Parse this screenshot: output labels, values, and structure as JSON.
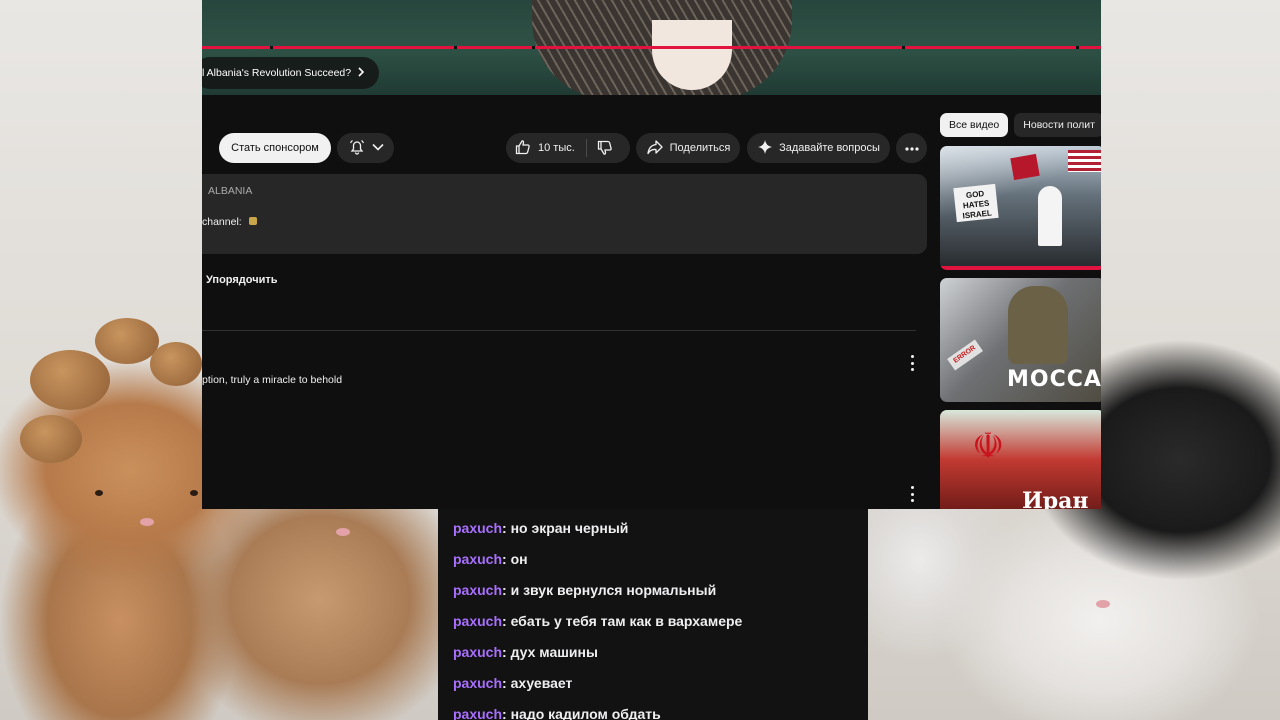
{
  "video": {
    "chapter_title": "l Albania's Revolution Succeed?"
  },
  "actions": {
    "sponsor_label": "Стать спонсором",
    "likes_count": "10 тыс.",
    "share_label": "Поделиться",
    "ask_label": "Задавайте вопросы"
  },
  "description": {
    "tag": "ALBANIA",
    "line": "channel:"
  },
  "comments": {
    "sort_label": "Упорядочить",
    "first_comment": "ption, truly a miracle to behold"
  },
  "sidebar": {
    "chips": [
      "Все видео",
      "Новости полит"
    ],
    "thumbnails": [
      {
        "text": "GOD HATES ISRAEL"
      },
      {
        "text": "МОССАД",
        "badge": "ERROR"
      },
      {
        "text": "Иран"
      }
    ]
  },
  "chat": {
    "username_color": "#a970ff",
    "messages": [
      {
        "user": "paxuch",
        "text": "но экран черный"
      },
      {
        "user": "paxuch",
        "text": "он"
      },
      {
        "user": "paxuch",
        "text": "и звук вернулся нормальный"
      },
      {
        "user": "paxuch",
        "text": "ебать у тебя там как в вархамере"
      },
      {
        "user": "paxuch",
        "text": "дух машины"
      },
      {
        "user": "paxuch",
        "text": "ахуевает"
      },
      {
        "user": "paxuch",
        "text": "надо кадилом обдать"
      }
    ]
  },
  "icons": {
    "bell": "bell-icon",
    "chevron": "chevron-down-icon",
    "like": "thumbs-up-icon",
    "dislike": "thumbs-down-icon",
    "share": "share-arrow-icon",
    "ask": "sparkle-icon",
    "more": "more-horizontal-icon",
    "kebab": "more-vertical-icon"
  },
  "colors": {
    "progress_red": "#e3133f",
    "yt_background": "#0f0f0f",
    "button_bg": "#272727"
  }
}
